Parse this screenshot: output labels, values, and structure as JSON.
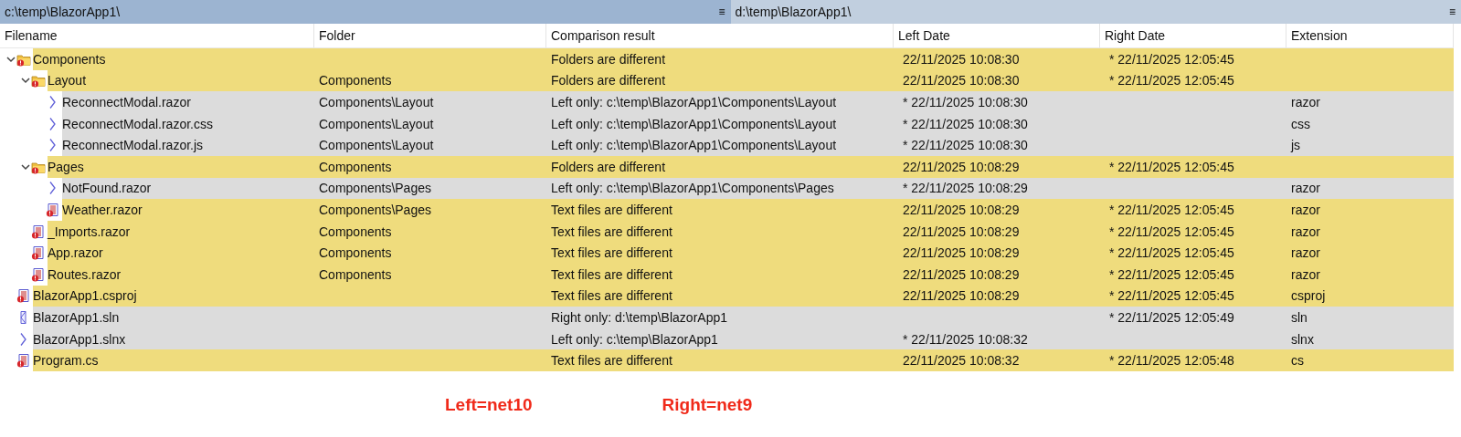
{
  "panes": [
    {
      "path": "c:\\temp\\BlazorApp1\\",
      "active": true,
      "menu": "≡"
    },
    {
      "path": "d:\\temp\\BlazorApp1\\",
      "active": false,
      "menu": "≡"
    }
  ],
  "table": {
    "columns": [
      "Filename",
      "Folder",
      "Comparison result",
      "Left Date",
      "Right Date",
      "Extension"
    ],
    "rows": [
      {
        "name": "Components",
        "kind": "folderdiff",
        "expanded": true,
        "result": "Folders are different",
        "left_date": "22/11/2025 10:08:30",
        "right_date": "* 22/11/2025 12:05:45",
        "children": [
          {
            "name": "Layout",
            "kind": "folderdiff",
            "expanded": true,
            "folder": "Components",
            "result": "Folders are different",
            "left_date": "22/11/2025 10:08:30",
            "right_date": "* 22/11/2025 12:05:45",
            "children": [
              {
                "name": "ReconnectModal.razor",
                "kind": "leftonly",
                "folder": "Components\\Layout",
                "result": "Left only: c:\\temp\\BlazorApp1\\Components\\Layout",
                "left_date": "* 22/11/2025 10:08:30",
                "extension": "razor"
              },
              {
                "name": "ReconnectModal.razor.css",
                "kind": "leftonly",
                "folder": "Components\\Layout",
                "result": "Left only: c:\\temp\\BlazorApp1\\Components\\Layout",
                "left_date": "* 22/11/2025 10:08:30",
                "extension": "css"
              },
              {
                "name": "ReconnectModal.razor.js",
                "kind": "leftonly",
                "folder": "Components\\Layout",
                "result": "Left only: c:\\temp\\BlazorApp1\\Components\\Layout",
                "left_date": "* 22/11/2025 10:08:30",
                "extension": "js"
              }
            ]
          },
          {
            "name": "Pages",
            "kind": "folderdiff",
            "expanded": true,
            "folder": "Components",
            "result": "Folders are different",
            "left_date": "22/11/2025 10:08:29",
            "right_date": "* 22/11/2025 12:05:45",
            "children": [
              {
                "name": "NotFound.razor",
                "kind": "leftonly",
                "folder": "Components\\Pages",
                "result": "Left only: c:\\temp\\BlazorApp1\\Components\\Pages",
                "left_date": "* 22/11/2025 10:08:29",
                "extension": "razor"
              },
              {
                "name": "Weather.razor",
                "kind": "filediff",
                "folder": "Components\\Pages",
                "result": "Text files are different",
                "left_date": "22/11/2025 10:08:29",
                "right_date": "* 22/11/2025 12:05:45",
                "extension": "razor"
              }
            ]
          },
          {
            "name": "_Imports.razor",
            "kind": "filediff",
            "folder": "Components",
            "result": "Text files are different",
            "left_date": "22/11/2025 10:08:29",
            "right_date": "* 22/11/2025 12:05:45",
            "extension": "razor"
          },
          {
            "name": "App.razor",
            "kind": "filediff",
            "folder": "Components",
            "result": "Text files are different",
            "left_date": "22/11/2025 10:08:29",
            "right_date": "* 22/11/2025 12:05:45",
            "extension": "razor"
          },
          {
            "name": "Routes.razor",
            "kind": "filediff",
            "folder": "Components",
            "result": "Text files are different",
            "left_date": "22/11/2025 10:08:29",
            "right_date": "* 22/11/2025 12:05:45",
            "extension": "razor"
          }
        ]
      },
      {
        "name": "BlazorApp1.csproj",
        "kind": "filediff",
        "result": "Text files are different",
        "left_date": "22/11/2025 10:08:29",
        "right_date": "* 22/11/2025 12:05:45",
        "extension": "csproj"
      },
      {
        "name": "BlazorApp1.sln",
        "kind": "rightonly",
        "result": "Right only: d:\\temp\\BlazorApp1",
        "right_date": "* 22/11/2025 12:05:49",
        "extension": "sln"
      },
      {
        "name": "BlazorApp1.slnx",
        "kind": "leftonly",
        "result": "Left only: c:\\temp\\BlazorApp1",
        "left_date": "* 22/11/2025 10:08:32",
        "extension": "slnx"
      },
      {
        "name": "Program.cs",
        "kind": "filediff",
        "result": "Text files are different",
        "left_date": "22/11/2025 10:08:32",
        "right_date": "* 22/11/2025 12:05:48",
        "extension": "cs"
      }
    ]
  },
  "notes": [
    "Left=net10",
    "Right=net9"
  ]
}
